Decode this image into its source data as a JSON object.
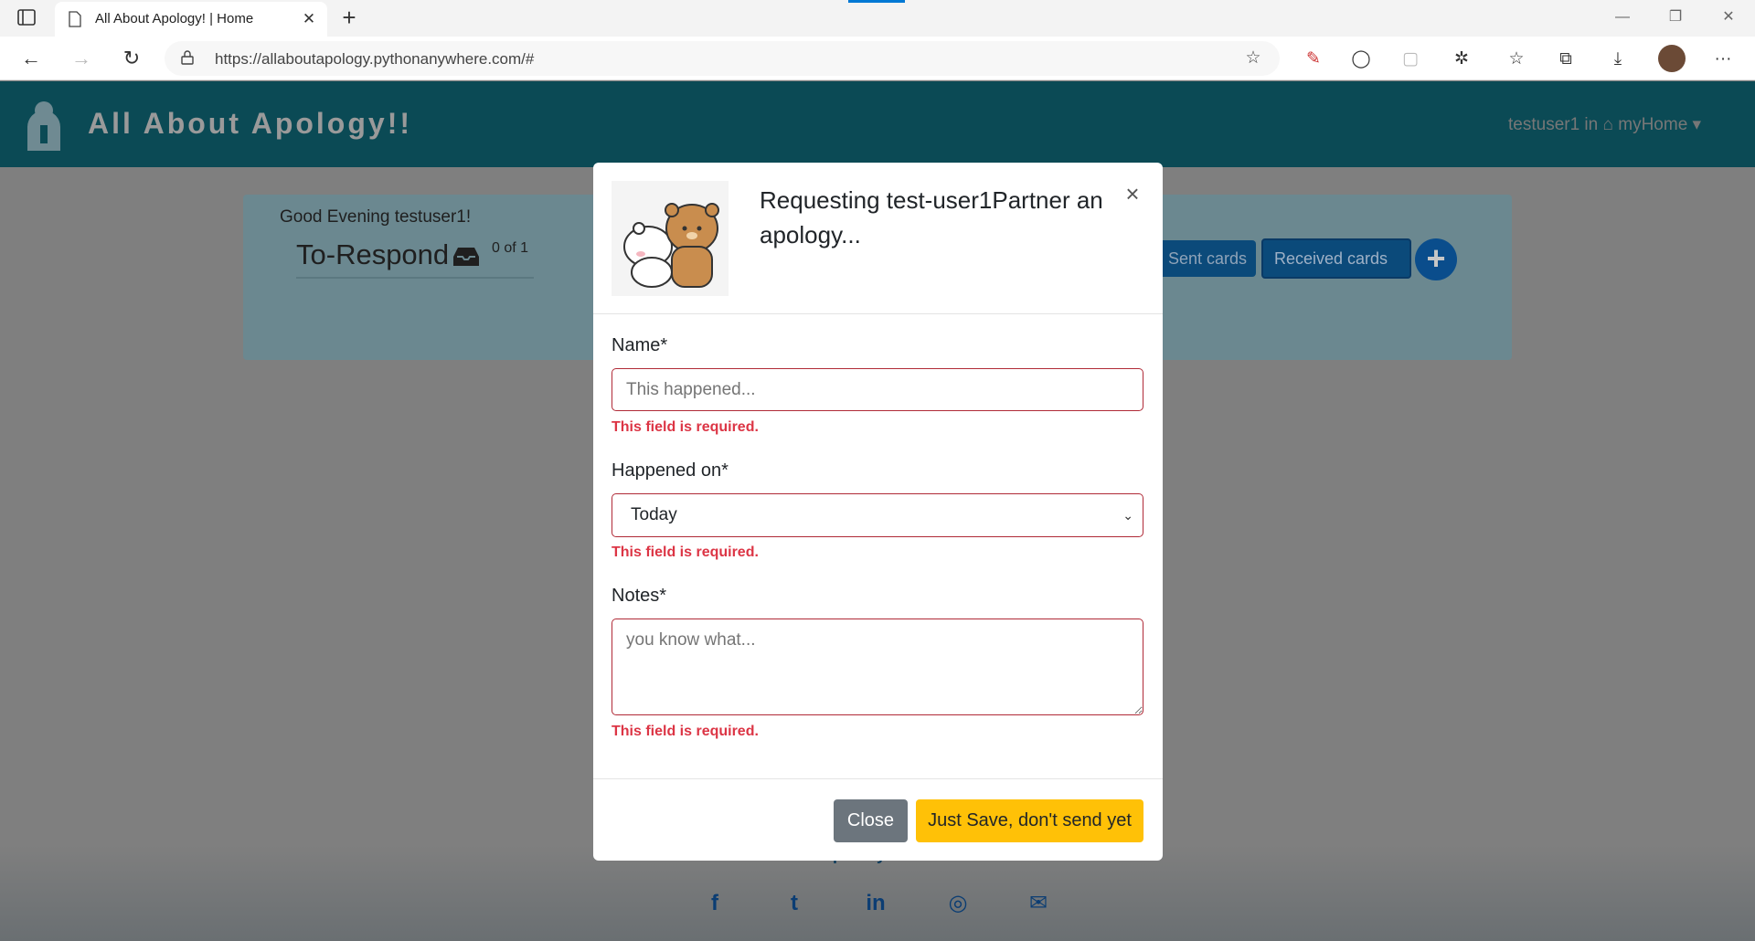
{
  "browser": {
    "tab_title": "All About Apology! | Home",
    "tab_close": "✕",
    "new_tab": "+",
    "url": "https://allaboutapology.pythonanywhere.com/#",
    "menu_dots": "···"
  },
  "navbar": {
    "brand": "All About Apology!!",
    "user_menu": "testuser1 in ⌂ myHome ▾"
  },
  "dashboard": {
    "greeting": "Good Evening testuser1!",
    "section_title": "To-Respond",
    "count": "0 of 1",
    "sent_cards_label": "Sent cards",
    "received_cards_label": "Received cards",
    "add_label": "+"
  },
  "footer": {
    "developed_by": "Developed by Thoushif",
    "social": [
      "f",
      "t",
      "in",
      "◎",
      "✉"
    ]
  },
  "modal": {
    "title": "Requesting test-user1Partner an apology...",
    "close_x": "×",
    "name_label": "Name*",
    "name_placeholder": "This happened...",
    "happened_label": "Happened on*",
    "happened_value": "Today",
    "notes_label": "Notes*",
    "notes_placeholder": "you know what...",
    "required_error": "This field is required.",
    "close_button": "Close",
    "save_button": "Just Save, don't send yet"
  },
  "colors": {
    "navbar": "#0b4a55",
    "error": "#dc3545",
    "save_button": "#ffc107",
    "close_button": "#6c757d"
  }
}
